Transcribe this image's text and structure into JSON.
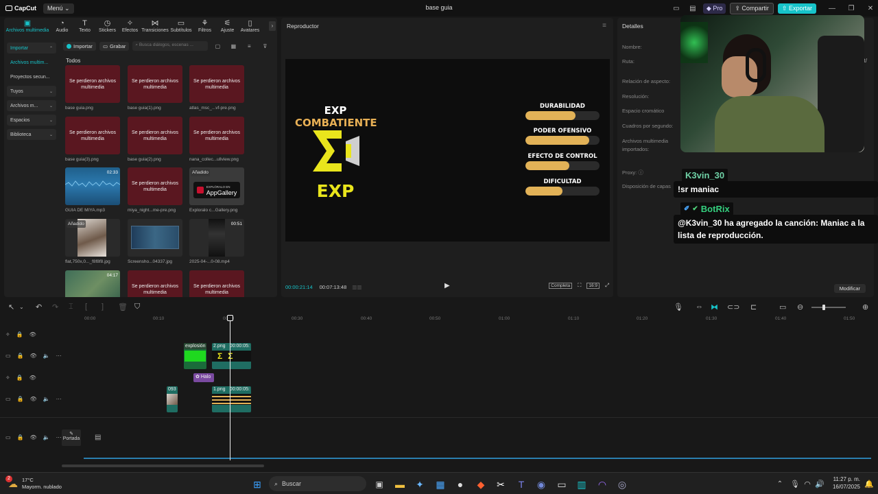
{
  "titlebar": {
    "app_name": "CapCut",
    "menu_label": "Menú",
    "project_title": "base guia",
    "pro_label": "Pro",
    "share_label": "Compartir",
    "export_label": "Exportar"
  },
  "toolbar": {
    "tabs": [
      {
        "label": "Archivos multimedia",
        "icon": "media-icon"
      },
      {
        "label": "Audio",
        "icon": "audio-icon"
      },
      {
        "label": "Texto",
        "icon": "text-icon"
      },
      {
        "label": "Stickers",
        "icon": "sticker-icon"
      },
      {
        "label": "Efectos",
        "icon": "effects-icon"
      },
      {
        "label": "Transiciones",
        "icon": "transition-icon"
      },
      {
        "label": "Subtítulos",
        "icon": "subtitle-icon"
      },
      {
        "label": "Filtros",
        "icon": "filter-icon"
      },
      {
        "label": "Ajuste",
        "icon": "adjust-icon"
      },
      {
        "label": "Avatares",
        "icon": "avatar-icon"
      }
    ]
  },
  "sidebar": {
    "items": [
      {
        "label": "Importar"
      },
      {
        "label": "Archivos multim..."
      },
      {
        "label": "Proyectos secun..."
      },
      {
        "label": "Tuyos"
      },
      {
        "label": "Archivos m..."
      },
      {
        "label": "Espacios"
      },
      {
        "label": "Biblioteca"
      }
    ]
  },
  "media": {
    "import_label": "Importar",
    "record_label": "Grabar",
    "search_placeholder": "Busca diálogos, escenas ...",
    "all_label": "Todos",
    "lost_text": "Se perdieron archivos multimedia",
    "added_badge": "Añadido",
    "appgallery_small": "EXPLÓRALO EN",
    "appgallery_big": "AppGallery",
    "items": [
      {
        "name": "base guia.png",
        "lost": true
      },
      {
        "name": "base guia(1).png",
        "lost": true
      },
      {
        "name": "atlas_msc_...vf-pre.png",
        "lost": true
      },
      {
        "name": "base guia(3).png",
        "lost": true
      },
      {
        "name": "base guia(2).png",
        "lost": true
      },
      {
        "name": "nana_collec...ullview.png",
        "lost": true
      },
      {
        "name": "GUIA DE MIYA.mp3",
        "duration": "02:33"
      },
      {
        "name": "miya_night...me-pre.png",
        "lost": true
      },
      {
        "name": "Exploralo c...Gallery.png"
      },
      {
        "name": "flat,750x,0..._f8f8f8.jpg"
      },
      {
        "name": "Screensho...04337.jpg"
      },
      {
        "name": "2025-04-...0-08.mp4",
        "duration": "00:51"
      },
      {
        "name": "",
        "duration": "04:17"
      },
      {
        "name": "",
        "lost": true
      },
      {
        "name": "",
        "lost": true
      }
    ]
  },
  "player": {
    "title": "Reproductor",
    "current_time": "00:00:21:14",
    "total_time": "00:07:13:48",
    "complete_label": "Completa",
    "ratio_label": "16:9",
    "canvas": {
      "exp_line1": "EXP",
      "exp_line2": "COMBATIENTE",
      "exp_bottom": "EXP",
      "bars": [
        {
          "label": "DURABILIDAD",
          "level": 0.68
        },
        {
          "label": "PODER OFENSIVO",
          "level": 0.86
        },
        {
          "label": "EFECTO DE CONTROL",
          "level": 0.59
        },
        {
          "label": "DIFICULTAD",
          "level": 0.5
        }
      ]
    }
  },
  "details": {
    "title": "Detalles",
    "rows": [
      "Nombre:",
      "Ruta:",
      "Relación de aspecto:",
      "Resolución:",
      "Espacio cromático",
      "Cuadros por segundo:",
      "Archivos multimedia importados:",
      "Proxy:",
      "Disposición de capas"
    ],
    "cut_text": "aft/",
    "modify_label": "Modificar"
  },
  "chat": [
    {
      "user": "K3vin_30",
      "user_color": "#6fd1a6",
      "message": "!sr maniac"
    },
    {
      "user": "BotRix",
      "user_color": "#35d07f",
      "message": "@K3vin_30 ha agregado la canción: Maniac a la lista de reproducción."
    }
  ],
  "timeline": {
    "ruler": [
      "00:00",
      "00:10",
      "00:20",
      "00:30",
      "00:40",
      "00:50",
      "01:00",
      "01:10",
      "01:20",
      "01:30",
      "01:40",
      "01:50"
    ],
    "clips": {
      "explosion": "explosión",
      "png2": "2.png",
      "time1": "00:00:05:",
      "halo": "Halo",
      "c093": "093",
      "png1": "1.png",
      "time2": "00:00:05:"
    },
    "cover_label": "Portada"
  },
  "taskbar": {
    "temperature": "17°C",
    "weather": "Mayorm. nublado",
    "weather_badge": "2",
    "search_label": "Buscar",
    "time": "11:27 p. m.",
    "date": "16/07/2025"
  }
}
